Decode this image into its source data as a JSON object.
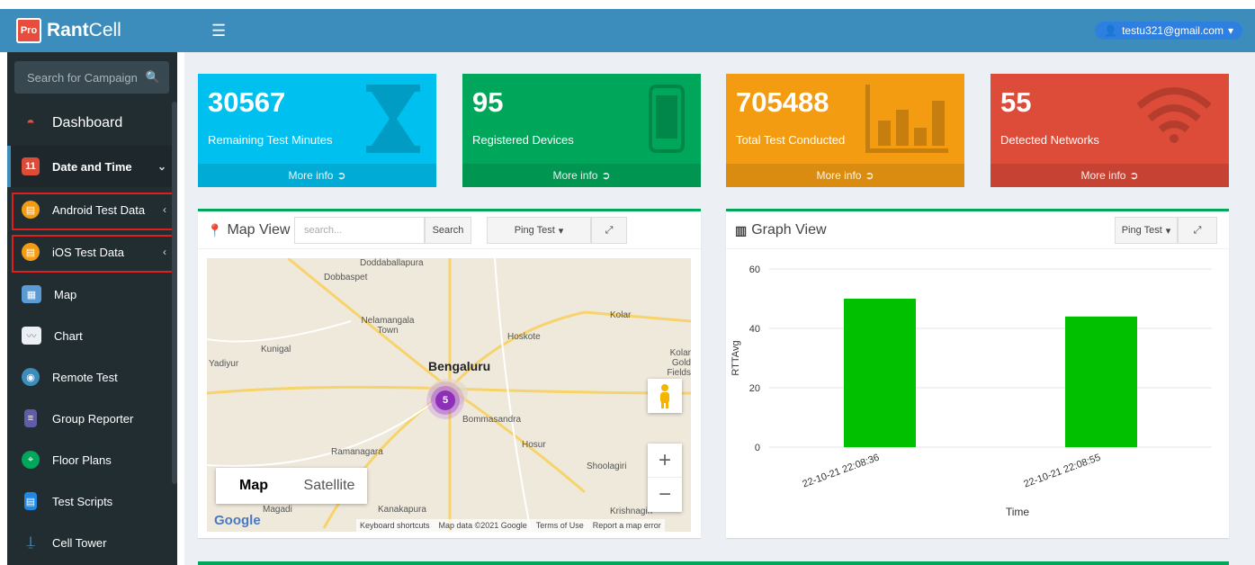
{
  "app": {
    "logo_badge": "Pro",
    "logo_bold": "Rant",
    "logo_rest": "Cell"
  },
  "header": {
    "menu_icon": "hamburger-icon",
    "user_email": "testu321@gmail.com"
  },
  "sidebar": {
    "search_placeholder": "Search for Campaign",
    "items": [
      {
        "label": "Dashboard",
        "icon": "dashboard-icon",
        "color": "#e74c3c"
      },
      {
        "label": "Date and Time",
        "icon": "calendar-icon",
        "color": "#dd4b39",
        "badge": "11"
      },
      {
        "label": "Android Test Data",
        "icon": "data-icon",
        "color": "#f39c12"
      },
      {
        "label": "iOS Test Data",
        "icon": "data-icon",
        "color": "#f39c12"
      },
      {
        "label": "Map",
        "icon": "map-icon",
        "color": "#3c8dbc"
      },
      {
        "label": "Chart",
        "icon": "chart-icon",
        "color": "#d2d6de"
      },
      {
        "label": "Remote Test",
        "icon": "remote-icon",
        "color": "#3c8dbc"
      },
      {
        "label": "Group Reporter",
        "icon": "report-icon",
        "color": "#605ca8"
      },
      {
        "label": "Floor Plans",
        "icon": "floorplan-icon",
        "color": "#00a65a"
      },
      {
        "label": "Test Scripts",
        "icon": "script-icon",
        "color": "#3c8dbc"
      },
      {
        "label": "Cell Tower",
        "icon": "tower-icon",
        "color": "#3c8dbc"
      }
    ]
  },
  "stats": [
    {
      "value": "30567",
      "label": "Remaining Test Minutes",
      "more": "More info",
      "color": "#00c0ef",
      "icon": "hourglass-icon"
    },
    {
      "value": "95",
      "label": "Registered Devices",
      "more": "More info",
      "color": "#00a65a",
      "icon": "mobile-icon"
    },
    {
      "value": "705488",
      "label": "Total Test Conducted",
      "more": "More info",
      "color": "#f39c12",
      "icon": "bar-chart-icon"
    },
    {
      "value": "55",
      "label": "Detected Networks",
      "more": "More info",
      "color": "#dd4b39",
      "icon": "wifi-icon"
    }
  ],
  "map_panel": {
    "title": "Map View",
    "search_placeholder": "search...",
    "search_button": "Search",
    "dropdown": "Ping Test",
    "map_type_map": "Map",
    "map_type_satellite": "Satellite",
    "cluster_count": "5",
    "attribution": [
      "Keyboard shortcuts",
      "Map data ©2021 Google",
      "Terms of Use",
      "Report a map error"
    ],
    "google": "Google",
    "places": [
      {
        "name": "Doddaballapura"
      },
      {
        "name": "Dobbaspet"
      },
      {
        "name": "Nelamangala Town"
      },
      {
        "name": "Kunigal"
      },
      {
        "name": "Yadiyur"
      },
      {
        "name": "Hoskote"
      },
      {
        "name": "Kolar"
      },
      {
        "name": "Kolar Gold Fields"
      },
      {
        "name": "Bengaluru"
      },
      {
        "name": "Bommasandra"
      },
      {
        "name": "Ramanagara"
      },
      {
        "name": "Hosur"
      },
      {
        "name": "Shoolagiri"
      },
      {
        "name": "Kanakapura"
      },
      {
        "name": "Krishnagiri"
      },
      {
        "name": "Magadi"
      }
    ]
  },
  "graph_panel": {
    "title": "Graph View",
    "dropdown": "Ping Test",
    "chart_data": {
      "type": "bar",
      "categories": [
        "22-10-21 22:08:36",
        "22-10-21 22:08:55"
      ],
      "values": [
        50,
        44
      ],
      "xlabel": "Time",
      "ylabel": "RTTAvg",
      "yticks": [
        "0",
        "20",
        "40",
        "60"
      ],
      "ylim": [
        0,
        60
      ],
      "bar_color": "#00c000",
      "grid": true
    }
  }
}
